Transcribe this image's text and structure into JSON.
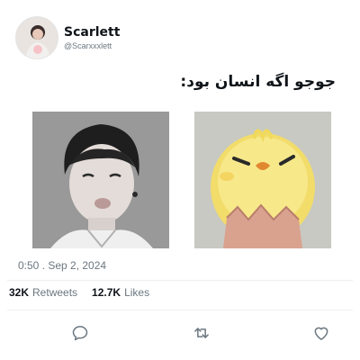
{
  "tweet": {
    "author": {
      "display_name": "Scarlett",
      "handle": "@Scarxxxlett"
    },
    "text": "جوجو اگه انسان بود:",
    "images": [
      "person-photo",
      "yellow-chick-photo"
    ],
    "timestamp": "0:50 . Sep 2, 2024",
    "stats": {
      "retweets_count": "32K",
      "retweets_label": "Retweets",
      "likes_count": "12.7K",
      "likes_label": "Likes"
    },
    "actions": [
      "reply-icon",
      "retweet-icon",
      "like-icon"
    ]
  },
  "colors": {
    "text_primary": "#0f1419",
    "text_secondary": "#6b7780",
    "divider": "#eceff1",
    "icon": "#6b7780"
  }
}
